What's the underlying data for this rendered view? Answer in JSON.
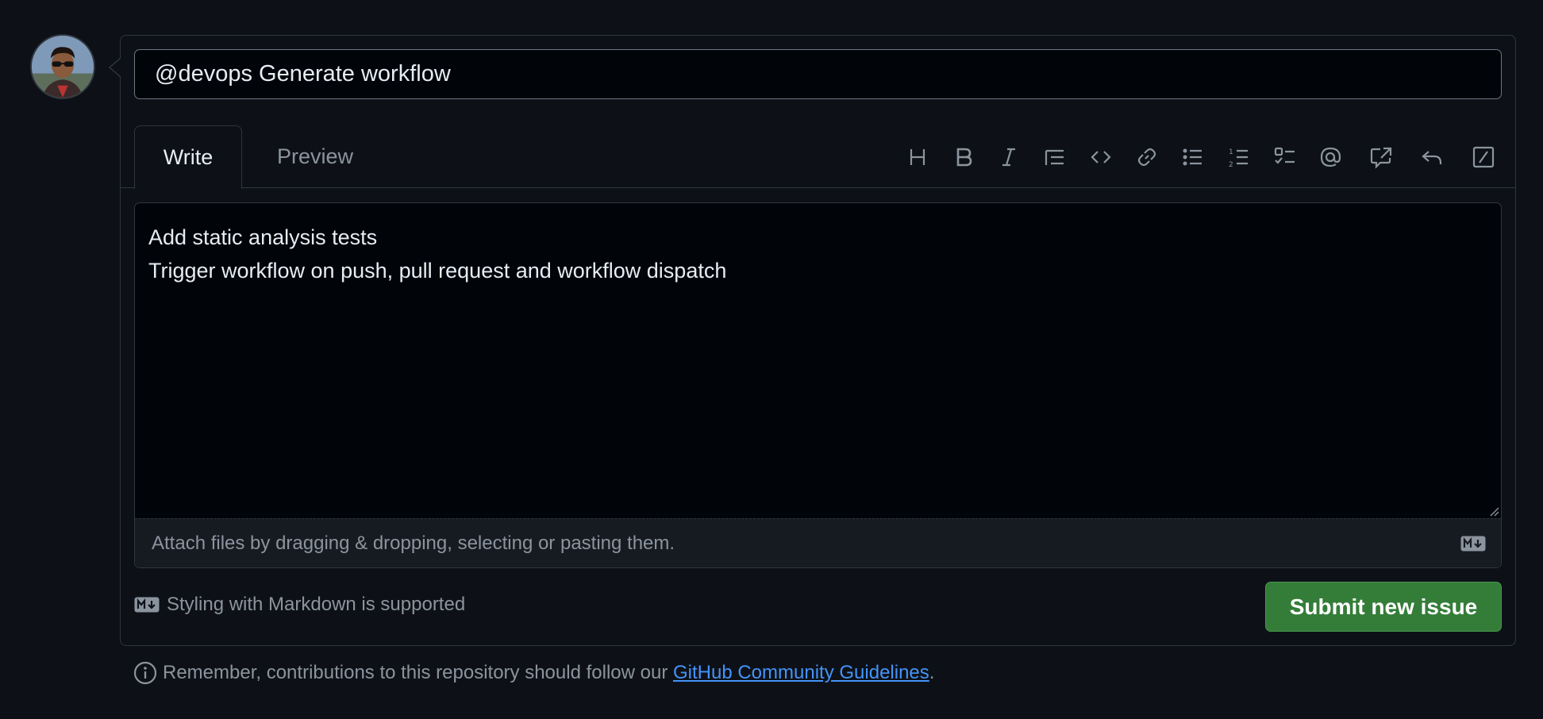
{
  "issue": {
    "title_value": "@devops Generate workflow",
    "body_lines": [
      "Add static analysis tests",
      "Trigger workflow on push, pull request and workflow dispatch"
    ]
  },
  "tabs": {
    "write": "Write",
    "preview": "Preview",
    "active": "Write"
  },
  "toolbar": {
    "icons": [
      "heading-icon",
      "bold-icon",
      "italic-icon",
      "quote-icon",
      "code-icon",
      "link-icon",
      "bulleted-list-icon",
      "numbered-list-icon",
      "task-list-icon",
      "mention-icon",
      "cross-reference-icon",
      "saved-replies-icon",
      "slash-commands-icon"
    ]
  },
  "attach": {
    "text": "Attach files by dragging & dropping, selecting or pasting them."
  },
  "footer": {
    "markdown_note": "Styling with Markdown is supported",
    "submit_label": "Submit new issue",
    "guidelines_prefix": "Remember, contributions to this repository should follow our ",
    "guidelines_link": "GitHub Community Guidelines",
    "guidelines_suffix": "."
  },
  "colors": {
    "background": "#0d1117",
    "submit": "#347d39",
    "link": "#4493f8",
    "muted_text": "#8b949e"
  }
}
